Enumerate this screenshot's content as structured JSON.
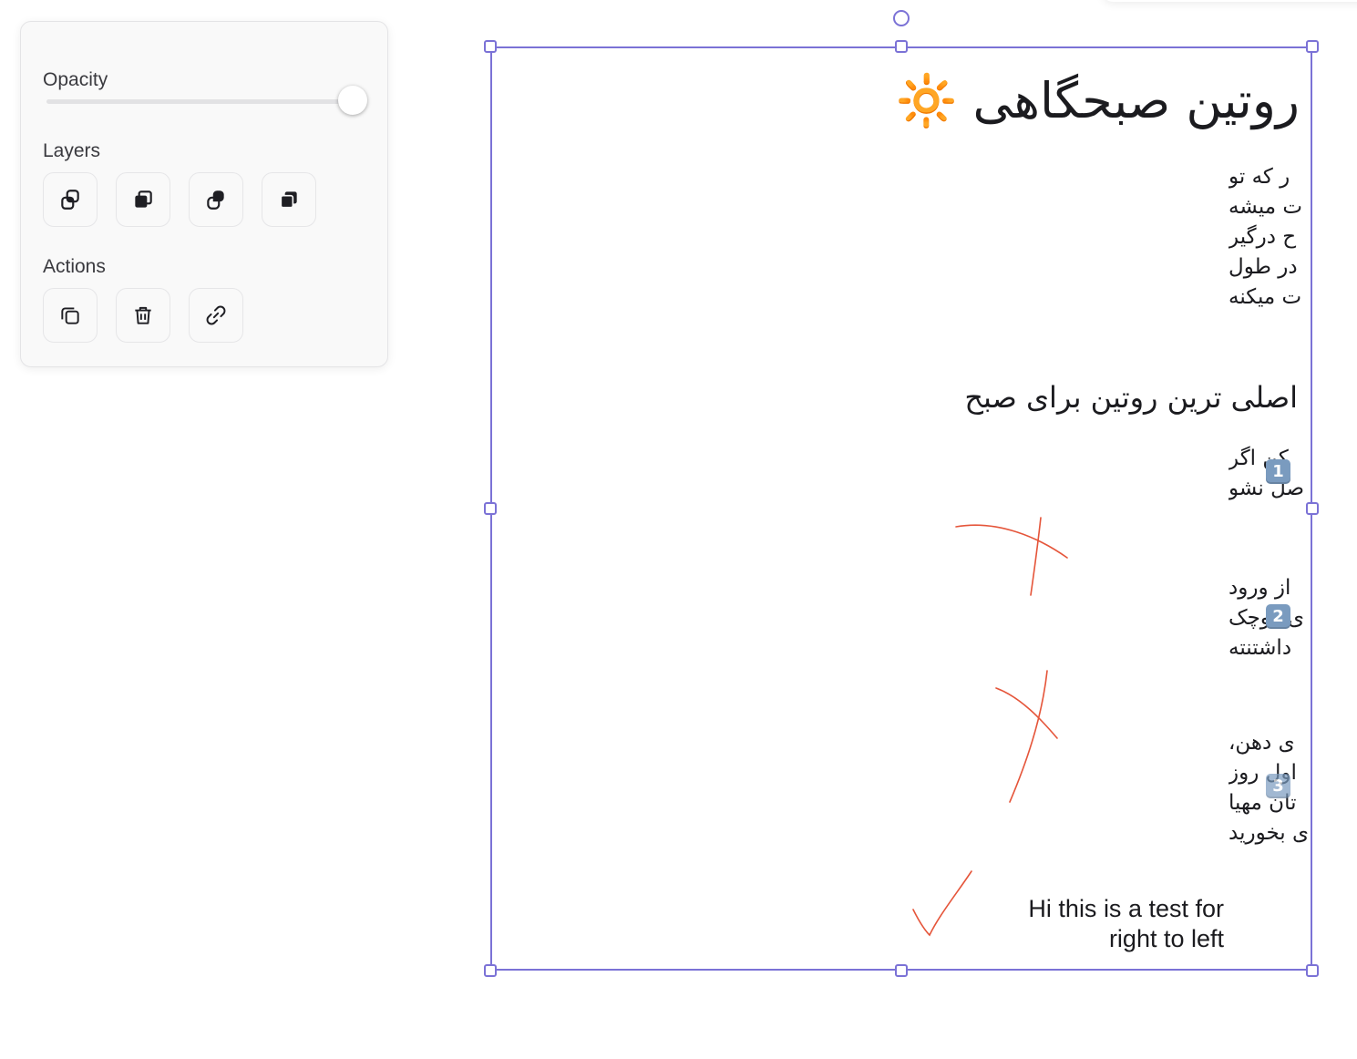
{
  "panel": {
    "opacity_label": "Opacity",
    "opacity_value": 1.0,
    "layers_label": "Layers",
    "layers_buttons": [
      "bring-to-front-icon",
      "bring-forward-icon",
      "send-backward-icon",
      "send-to-back-icon"
    ],
    "actions_label": "Actions",
    "actions_buttons": [
      "duplicate-icon",
      "delete-icon",
      "link-icon"
    ]
  },
  "canvas": {
    "title": "روتین صبحگاهی 🔆",
    "intro_lines": [
      "ر که تو",
      "ت میشه",
      "ح درگیر",
      "در طول",
      "ت میکنه"
    ],
    "subtitle": "اصلی ترین روتین برای صبح",
    "step1_lines": [
      "کن اگر",
      "صل نشو"
    ],
    "step1_badge": "1",
    "step2_lines": [
      "از ورود",
      "ی کوچک",
      "داشتنته"
    ],
    "step2_badge": "2",
    "step3_lines": [
      "ی دهن،",
      "اول روز",
      "تان مهیا",
      "ی بخورید"
    ],
    "step3_badge": "3",
    "english_text_line1": "Hi this is a test for",
    "english_text_line2": "right to left"
  },
  "colors": {
    "selection": "#7b72d6",
    "ink": "#e5553a",
    "panel_bg": "#f9f9f9"
  }
}
